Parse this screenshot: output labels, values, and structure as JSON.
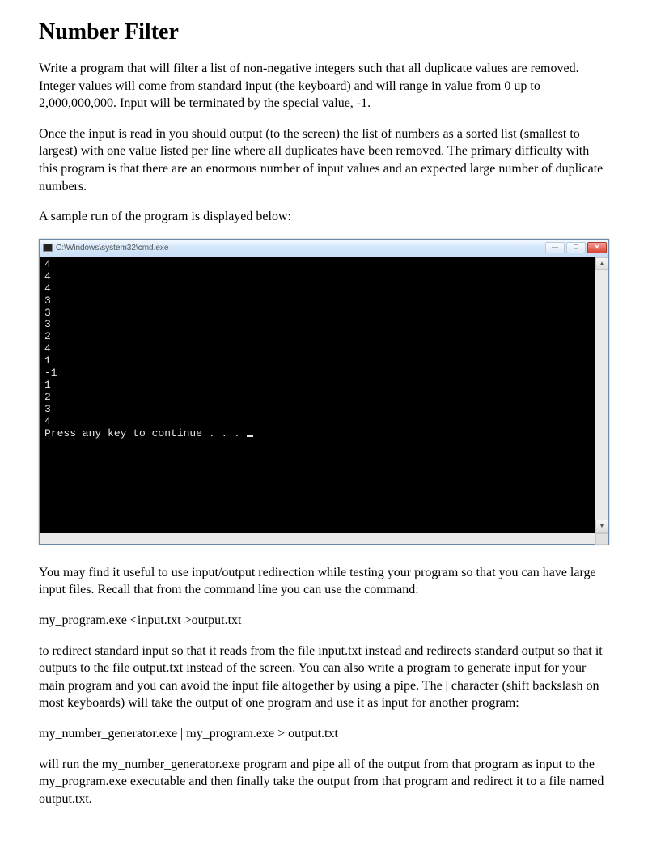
{
  "title": "Number Filter",
  "paragraphs": {
    "p1": "Write a program that will filter a list of non-negative integers such that all duplicate values are removed.  Integer values will come from standard input (the keyboard) and will range in value from 0 up to 2,000,000,000.  Input will be terminated by the special value, -1.",
    "p2": "Once the input is read in you should output (to the screen) the list of numbers as a sorted list (smallest to largest) with one value listed per line where all duplicates have been removed.  The primary difficulty with this program is that there are an enormous number of input values and an expected large number of duplicate numbers.",
    "p3": "A sample run of the program is displayed below:",
    "p4": "You may find it useful to use input/output redirection while testing your program so that you can have large input files.  Recall that from the command line you can use the command:",
    "p5": "my_program.exe  <input.txt    >output.txt",
    "p6": "to redirect standard input so that it reads from the file input.txt instead and redirects standard output so that it outputs to the file output.txt instead of the screen.  You can also write a program to generate input for your main program and you can avoid the input file altogether by using a pipe.  The | character (shift backslash on most keyboards) will take the output of one program and use it as input for another program:",
    "p7": "my_number_generator.exe | my_program.exe > output.txt",
    "p8": "will run the my_number_generator.exe program and pipe all of the output from that program as input to the my_program.exe executable and then finally take the output from that program and redirect it to a file named output.txt."
  },
  "terminal": {
    "title": "C:\\Windows\\system32\\cmd.exe",
    "lines": [
      "4",
      "4",
      "4",
      "3",
      "3",
      "3",
      "2",
      "4",
      "1",
      "-1",
      "1",
      "2",
      "3",
      "4",
      "Press any key to continue . . . "
    ],
    "buttons": {
      "min": "—",
      "max": "☐",
      "close": "✕"
    }
  }
}
